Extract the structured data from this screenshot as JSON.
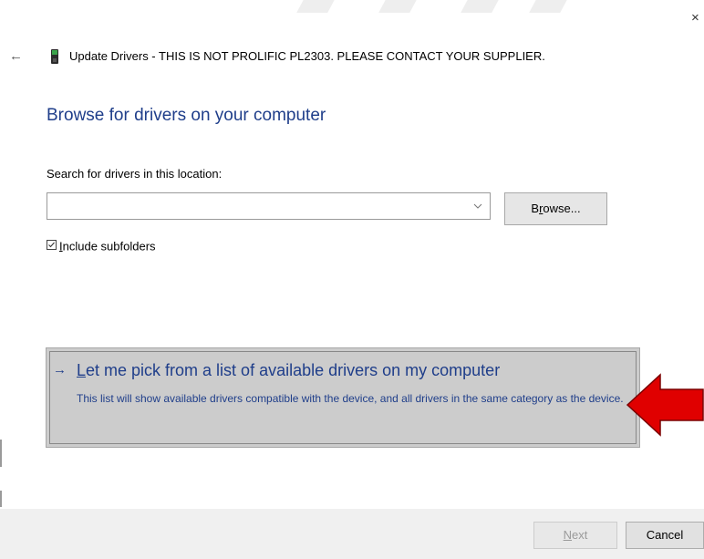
{
  "window": {
    "close_glyph": "×",
    "back_glyph": "←"
  },
  "header": {
    "title": "Update Drivers - THIS IS NOT PROLIFIC PL2303. PLEASE CONTACT YOUR SUPPLIER.",
    "icon": "usb-device-icon"
  },
  "main": {
    "heading": "Browse for drivers on your computer",
    "location_label": "Search for drivers in this location:",
    "path_value": "",
    "browse_label_pre": "B",
    "browse_label_accel": "r",
    "browse_label_post": "owse...",
    "include_subfolders": {
      "checked": true,
      "label_accel": "I",
      "label_rest": "nclude subfolders"
    },
    "pick_option": {
      "arrow_glyph": "→",
      "title_accel": "L",
      "title_rest": "et me pick from a list of available drivers on my computer",
      "description": "This list will show available drivers compatible with the device, and all drivers in the same category as the device."
    }
  },
  "annotation": {
    "color": "#e00000",
    "icon": "red-arrow-pointing-left"
  },
  "footer": {
    "next_accel": "N",
    "next_rest": "ext",
    "next_enabled": false,
    "cancel_label": "Cancel"
  },
  "colors": {
    "heading_blue": "#1f3e8a",
    "panel_gray": "#cccccc",
    "footer_gray": "#f0f0f0"
  }
}
